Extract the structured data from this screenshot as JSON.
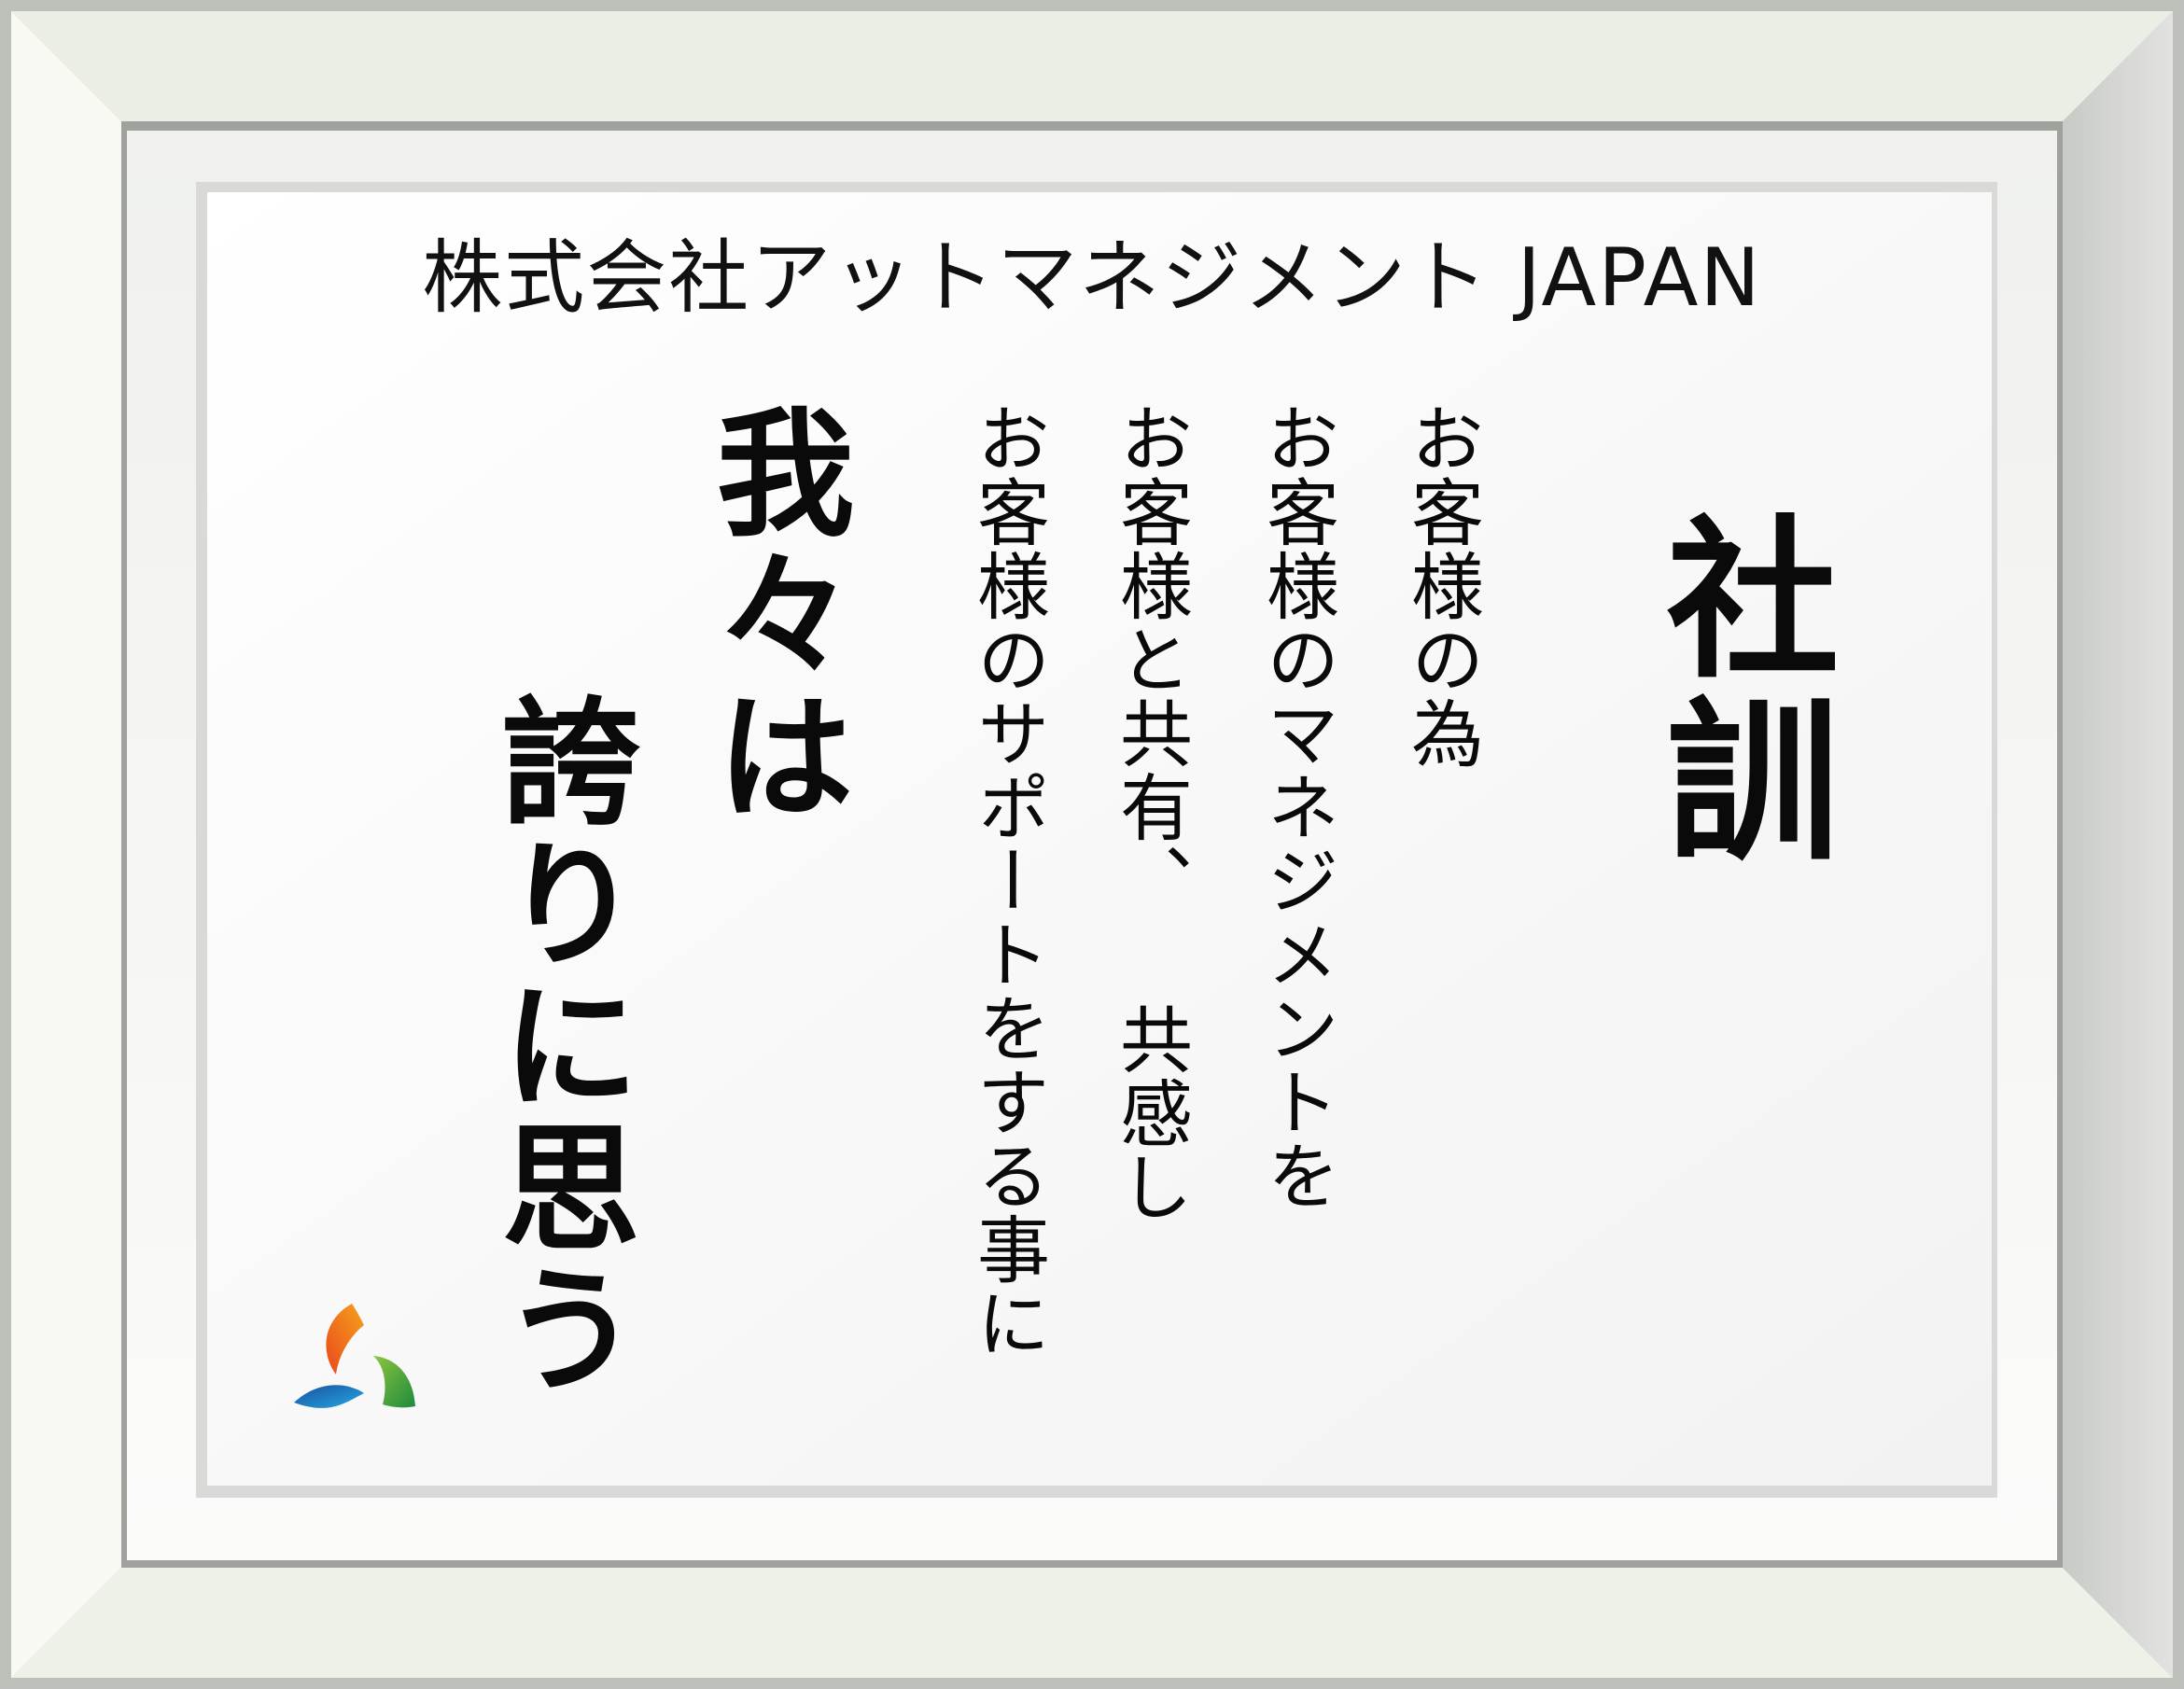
{
  "company_name": "株式会社アットマネジメント JAPAN",
  "title": "社訓",
  "principles": [
    "お客様の為",
    "お客様のマネジメントを",
    "お客様と共有、 共感し",
    "お客様のサポートをする事に"
  ],
  "motto": [
    "我々は",
    "誇りに思う"
  ],
  "logo": {
    "icon": "three-leaf-logo-icon",
    "colors": [
      "#f26522",
      "#1e73be",
      "#39a845"
    ]
  },
  "colors": {
    "frame_light": "#f6f8f1",
    "frame_mid": "#e8ebe2",
    "frame_shadow": "#c4c6c0",
    "paper": "#f8f8f8",
    "text": "#0a0a0a"
  }
}
